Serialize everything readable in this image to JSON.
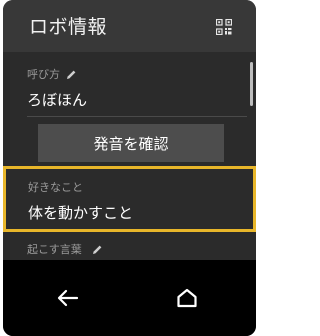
{
  "header": {
    "title": "ロボ情報"
  },
  "fields": {
    "call_name": {
      "label": "呼び方",
      "value": "ろぼほん"
    },
    "favorite": {
      "label": "好きなこと",
      "value": "体を動かすこと"
    },
    "wake_word": {
      "label": "起こす言葉"
    }
  },
  "buttons": {
    "confirm_pronunciation": "発音を確認"
  },
  "colors": {
    "accent": "#e8b62a",
    "header_bg": "#383838",
    "screen_bg": "#2b2b2b",
    "nav_bg": "#000000"
  },
  "icons": {
    "header_right": "qr-code-icon",
    "edit": "pencil-icon",
    "nav_back": "back-arrow-icon",
    "nav_home": "home-icon"
  }
}
